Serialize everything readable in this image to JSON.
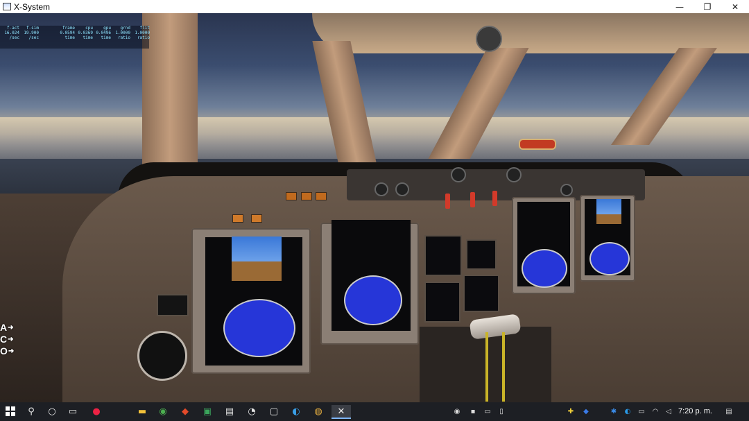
{
  "window": {
    "title": "X-System",
    "minimize_glyph": "—",
    "maximize_glyph": "❐",
    "close_glyph": "✕"
  },
  "fps_overlay": {
    "rows": [
      [
        "f-act",
        "f-sim",
        "frame",
        "cpu",
        "gpu",
        "grnd",
        "flit"
      ],
      [
        "16.024",
        "19.900",
        "0.0594",
        "0.0369",
        "0.0496",
        "1.0000",
        "1.0000"
      ],
      [
        "/sec",
        "/sec",
        "time",
        "time",
        "time",
        "ratio",
        "ratio"
      ]
    ]
  },
  "side_labels": [
    {
      "letter": "A",
      "arrow": "➜"
    },
    {
      "letter": "C",
      "arrow": "➜"
    },
    {
      "letter": "O",
      "arrow": "➜"
    }
  ],
  "taskbar": {
    "start_icon": "windows-logo",
    "apps": [
      "search",
      "cortana",
      "task-view",
      "chrome-like",
      "file-explorer",
      "chrome",
      "app-red",
      "app-green",
      "app-doc",
      "app-gauge",
      "app-monitor",
      "edge",
      "app-planet",
      "x-plane"
    ],
    "clock": "7:20 p. m."
  },
  "colors": {
    "taskbar_bg": "#1d1f24",
    "accent": "#7fb6ff"
  }
}
